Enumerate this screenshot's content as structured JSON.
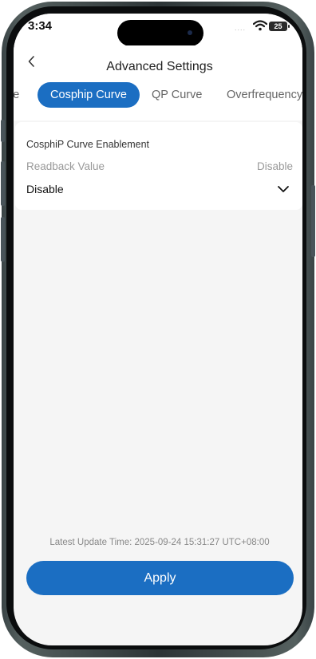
{
  "status_bar": {
    "time": "3:34",
    "signal_dots": "....",
    "battery_level": "25",
    "wifi_icon": "wifi-icon"
  },
  "header": {
    "title": "Advanced Settings",
    "back_icon": "chevron-left-icon"
  },
  "tabs": [
    {
      "label": "le",
      "active": false
    },
    {
      "label": "Cosphip Curve",
      "active": true
    },
    {
      "label": "QP Curve",
      "active": false
    },
    {
      "label": "Overfrequency",
      "active": false
    }
  ],
  "card": {
    "title": "CosphiP Curve Enablement",
    "readback_label": "Readback Value",
    "readback_value": "Disable",
    "selected_value": "Disable",
    "dropdown_icon": "chevron-down-icon"
  },
  "footer": {
    "update_label": "Latest Update Time:",
    "update_value": "2025-09-24 15:31:27 UTC+08:00",
    "apply_label": "Apply"
  },
  "colors": {
    "accent": "#1b6ec2",
    "background": "#f5f5f5"
  }
}
